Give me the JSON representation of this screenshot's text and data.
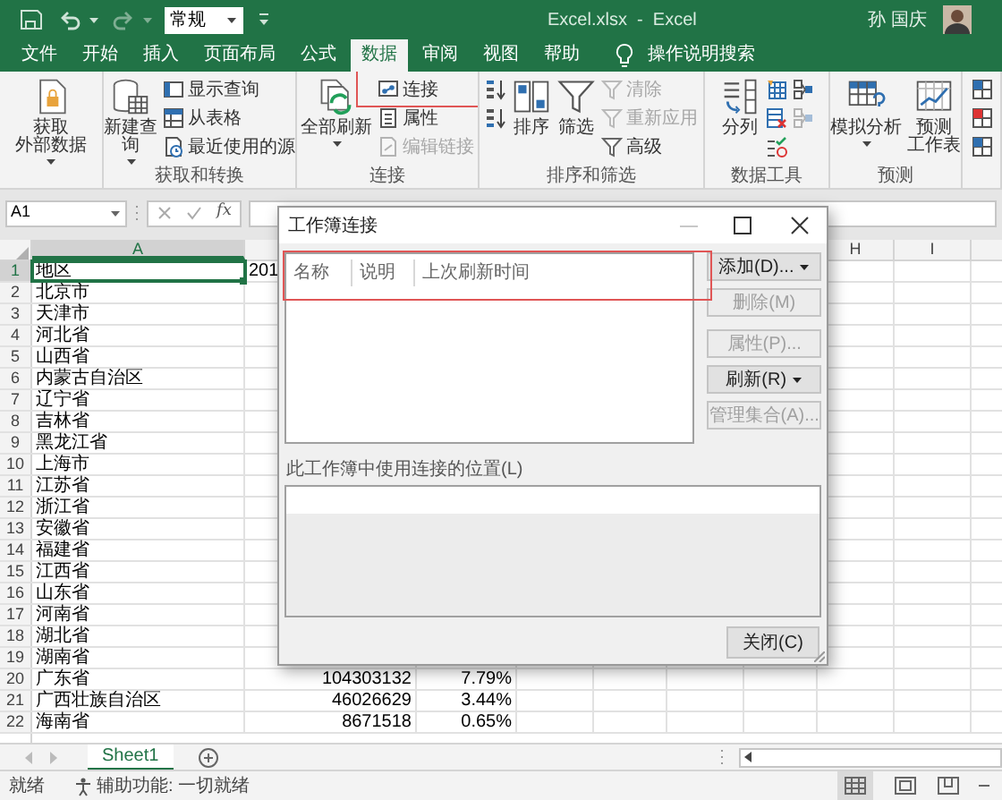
{
  "title_bar": {
    "number_format": "常规",
    "title": "Excel.xlsx  -  Excel",
    "user": "孙 国庆"
  },
  "tabs": [
    {
      "label": "文件",
      "selected": false
    },
    {
      "label": "开始",
      "selected": false
    },
    {
      "label": "插入",
      "selected": false
    },
    {
      "label": "页面布局",
      "selected": false
    },
    {
      "label": "公式",
      "selected": false
    },
    {
      "label": "数据",
      "selected": true
    },
    {
      "label": "审阅",
      "selected": false
    },
    {
      "label": "视图",
      "selected": false
    },
    {
      "label": "帮助",
      "selected": false
    }
  ],
  "tell_me": "操作说明搜索",
  "ribbon_groups": [
    {
      "items": [
        {
          "kind": "large",
          "lines": [
            "获取",
            "外部数据"
          ],
          "menu": true,
          "disabled": false
        }
      ]
    },
    {
      "label": "获取和转换",
      "items": [
        {
          "kind": "large",
          "lines": [
            "新建查",
            "询"
          ],
          "menu": true,
          "disabled": false
        },
        {
          "kind": "small",
          "label": "显示查询",
          "disabled": false
        },
        {
          "kind": "small",
          "label": "从表格",
          "disabled": false
        },
        {
          "kind": "small",
          "label": "最近使用的源",
          "disabled": false
        }
      ]
    },
    {
      "label": "连接",
      "items": [
        {
          "kind": "large",
          "lines": [
            "全部刷新"
          ],
          "menu": true,
          "disabled": false
        },
        {
          "kind": "small",
          "label": "连接",
          "disabled": false,
          "highlighted": true
        },
        {
          "kind": "small",
          "label": "属性",
          "disabled": false
        },
        {
          "kind": "small",
          "label": "编辑链接",
          "disabled": true
        }
      ]
    },
    {
      "label": "排序和筛选",
      "items": [
        {
          "kind": "icon",
          "disabled": false
        },
        {
          "kind": "icon",
          "disabled": false
        },
        {
          "kind": "large",
          "lines": [
            "排序"
          ],
          "disabled": false
        },
        {
          "kind": "large",
          "lines": [
            "筛选"
          ],
          "disabled": false
        },
        {
          "kind": "small",
          "label": "清除",
          "disabled": true
        },
        {
          "kind": "small",
          "label": "重新应用",
          "disabled": true
        },
        {
          "kind": "small",
          "label": "高级",
          "disabled": false
        }
      ]
    },
    {
      "label": "数据工具",
      "items": [
        {
          "kind": "large",
          "lines": [
            "分列"
          ],
          "disabled": false
        },
        {
          "kind": "icon",
          "disabled": false
        },
        {
          "kind": "icon",
          "disabled": false
        },
        {
          "kind": "icon",
          "disabled": false
        },
        {
          "kind": "icon",
          "disabled": false
        },
        {
          "kind": "icon",
          "disabled": true
        }
      ]
    },
    {
      "label": "预测",
      "items": [
        {
          "kind": "large",
          "lines": [
            "模拟分析"
          ],
          "menu": true,
          "disabled": false
        },
        {
          "kind": "large",
          "lines": [
            "预测",
            "工作表"
          ],
          "disabled": false
        }
      ]
    },
    {
      "items": [
        {
          "kind": "icon",
          "disabled": false
        },
        {
          "kind": "icon",
          "disabled": false
        },
        {
          "kind": "icon",
          "disabled": false
        }
      ]
    }
  ],
  "formula_bar": {
    "name_box": "A1",
    "function_label": "fx"
  },
  "column_headers": [
    {
      "label": "A",
      "selected": true
    },
    {
      "label": "H",
      "selected": false
    },
    {
      "label": "I",
      "selected": false
    }
  ],
  "rows": [
    {
      "number": "1",
      "kind": "header",
      "selected": true,
      "cells": [
        "地区",
        "201"
      ]
    },
    {
      "number": "2",
      "kind": "data",
      "selected": false,
      "cells": [
        "北京市"
      ]
    },
    {
      "number": "3",
      "kind": "data",
      "selected": false,
      "cells": [
        "天津市"
      ]
    },
    {
      "number": "4",
      "kind": "data",
      "selected": false,
      "cells": [
        "河北省"
      ]
    },
    {
      "number": "5",
      "kind": "data",
      "selected": false,
      "cells": [
        "山西省"
      ]
    },
    {
      "number": "6",
      "kind": "data",
      "selected": false,
      "cells": [
        "内蒙古自治区"
      ]
    },
    {
      "number": "7",
      "kind": "data",
      "selected": false,
      "cells": [
        "辽宁省"
      ]
    },
    {
      "number": "8",
      "kind": "data",
      "selected": false,
      "cells": [
        "吉林省"
      ]
    },
    {
      "number": "9",
      "kind": "data",
      "selected": false,
      "cells": [
        "黑龙江省"
      ]
    },
    {
      "number": "10",
      "kind": "data",
      "selected": false,
      "cells": [
        "上海市"
      ]
    },
    {
      "number": "11",
      "kind": "data",
      "selected": false,
      "cells": [
        "江苏省"
      ]
    },
    {
      "number": "12",
      "kind": "data",
      "selected": false,
      "cells": [
        "浙江省"
      ]
    },
    {
      "number": "13",
      "kind": "data",
      "selected": false,
      "cells": [
        "安徽省"
      ]
    },
    {
      "number": "14",
      "kind": "data",
      "selected": false,
      "cells": [
        "福建省"
      ]
    },
    {
      "number": "15",
      "kind": "data",
      "selected": false,
      "cells": [
        "江西省"
      ]
    },
    {
      "number": "16",
      "kind": "data",
      "selected": false,
      "cells": [
        "山东省"
      ]
    },
    {
      "number": "17",
      "kind": "data",
      "selected": false,
      "cells": [
        "河南省"
      ]
    },
    {
      "number": "18",
      "kind": "data",
      "selected": false,
      "cells": [
        "湖北省"
      ]
    },
    {
      "number": "19",
      "kind": "data",
      "selected": false,
      "cells": [
        "湖南省"
      ]
    },
    {
      "number": "20",
      "kind": "data",
      "selected": false,
      "cells": [
        "广东省",
        "104303132",
        "7.79%"
      ]
    },
    {
      "number": "21",
      "kind": "data",
      "selected": false,
      "cells": [
        "广西壮族自治区",
        "46026629",
        "3.44%"
      ]
    },
    {
      "number": "22",
      "kind": "data",
      "selected": false,
      "cells": [
        "海南省",
        "8671518",
        "0.65%"
      ]
    }
  ],
  "sheets": [
    {
      "label": "Sheet1",
      "selected": true
    }
  ],
  "status_bar": {
    "status": "就绪",
    "accessibility": "辅助功能: 一切就绪"
  },
  "dialog": {
    "title": "工作簿连接",
    "header_highlighted": true,
    "columns": [
      "名称",
      "说明",
      "上次刷新时间"
    ],
    "button_groups": [
      [
        {
          "label": "添加(D)...",
          "disabled": false,
          "menu": true
        },
        {
          "label": "删除(M)",
          "disabled": true,
          "menu": false
        }
      ],
      [
        {
          "label": "属性(P)...",
          "disabled": true,
          "menu": false
        },
        {
          "label": "刷新(R)",
          "disabled": false,
          "menu": true
        },
        {
          "label": "管理集合(A)...",
          "disabled": true,
          "menu": false
        }
      ]
    ],
    "locations_label": "此工作簿中使用连接的位置(L)",
    "close_button": "关闭(C)"
  }
}
